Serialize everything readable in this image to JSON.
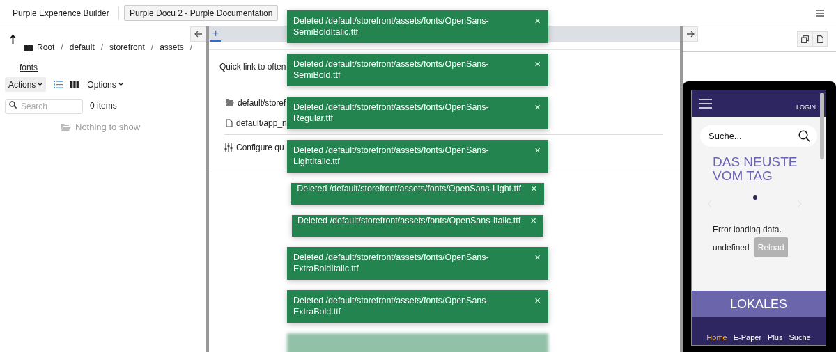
{
  "topbar": {
    "app_title": "Purple Experience Builder",
    "project_button": "Purple Docu 2 - Purple Documentation"
  },
  "file_browser": {
    "breadcrumb": [
      "Root",
      "default",
      "storefront",
      "assets"
    ],
    "separator": "/",
    "current": "fonts",
    "actions_label": "Actions",
    "options_label": "Options",
    "view_modes": [
      {
        "kind": "list",
        "selected": true
      },
      {
        "kind": "grid",
        "selected": false
      }
    ],
    "search": {
      "placeholder": "Search"
    },
    "item_count": "0 items",
    "empty_text": "Nothing to show"
  },
  "editor": {
    "tabs": [
      {
        "label": "+",
        "selected": true
      }
    ],
    "quick_link_intro": "Quick link to often",
    "quick_links": [
      {
        "kind": "folder",
        "label": "default/storef"
      },
      {
        "kind": "file",
        "label": "default/app_n"
      }
    ],
    "configure_link": "Configure qu"
  },
  "preview": {
    "header_login": "LOGIN",
    "search_placeholder": "Suche...",
    "headline": "DAS NEUSTE VOM TAG",
    "error_text": "Error loading data.",
    "undefined_text": "undefined",
    "reload_label": "Reload",
    "section_title": "LOKALES",
    "nav": [
      {
        "label": "Home",
        "selected": true
      },
      {
        "label": "E-Paper",
        "selected": false
      },
      {
        "label": "Plus",
        "selected": false
      },
      {
        "label": "Suche",
        "selected": false
      }
    ]
  },
  "toasts": [
    {
      "kind": "wrapped",
      "message": "Deleted /default/storefront/assets/fonts/OpenSans-SemiBoldItalic.ttf",
      "close": "×"
    },
    {
      "kind": "wrapped",
      "message": "Deleted /default/storefront/assets/fonts/OpenSans-SemiBold.ttf",
      "close": "×"
    },
    {
      "kind": "wrapped",
      "message": "Deleted /default/storefront/assets/fonts/OpenSans-Regular.ttf",
      "close": "×"
    },
    {
      "kind": "wrapped",
      "message": "Deleted /default/storefront/assets/fonts/OpenSans-LightItalic.ttf",
      "close": "×"
    },
    {
      "kind": "single",
      "message": "Deleted /default/storefront/assets/fonts/OpenSans-Light.ttf",
      "close": "×"
    },
    {
      "kind": "single",
      "message": "Deleted /default/storefront/assets/fonts/OpenSans-Italic.ttf",
      "close": "×"
    },
    {
      "kind": "wrapped",
      "message": "Deleted /default/storefront/assets/fonts/OpenSans-ExtraBoldItalic.ttf",
      "close": "×"
    },
    {
      "kind": "wrapped",
      "message": "Deleted /default/storefront/assets/fonts/OpenSans-ExtraBold.ttf",
      "close": "×"
    },
    {
      "kind": "faded"
    }
  ]
}
